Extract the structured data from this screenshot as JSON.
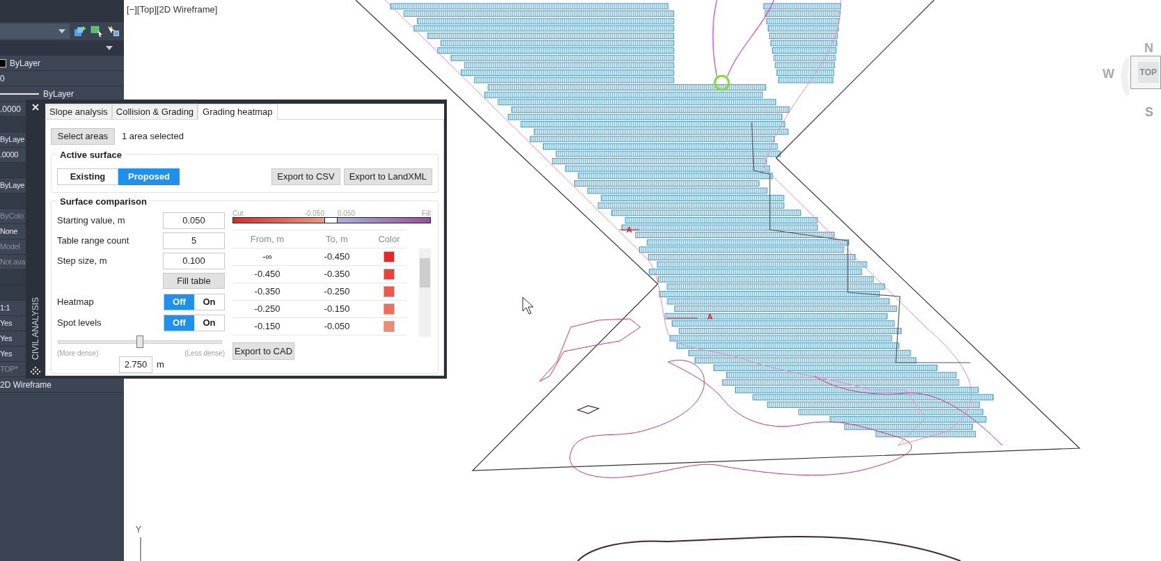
{
  "viewport_label": "[−][Top][2D Wireframe]",
  "properties": {
    "rows": [
      {
        "kind": "swatch",
        "text": "ByLayer",
        "disabled": false
      },
      {
        "kind": "value",
        "text": "0",
        "disabled": false
      },
      {
        "kind": "line",
        "text": "ByLayer",
        "disabled": false
      },
      {
        "kind": "value",
        "text": ".0000",
        "disabled": false
      },
      {
        "kind": "section"
      },
      {
        "kind": "value",
        "text": "ByLaye",
        "disabled": false
      },
      {
        "kind": "value",
        "text": ".0000",
        "disabled": false
      },
      {
        "kind": "section"
      },
      {
        "kind": "value",
        "text": "ByLaye",
        "disabled": false
      },
      {
        "kind": "section"
      },
      {
        "kind": "value",
        "text": "ByColo",
        "disabled": true
      },
      {
        "kind": "value",
        "text": "None",
        "disabled": false
      },
      {
        "kind": "value",
        "text": "Model",
        "disabled": true
      },
      {
        "kind": "value",
        "text": "Not ava",
        "disabled": true
      },
      {
        "kind": "section"
      },
      {
        "kind": "section"
      },
      {
        "kind": "value",
        "text": "1:1",
        "disabled": false
      },
      {
        "kind": "value",
        "text": "Yes",
        "disabled": false
      },
      {
        "kind": "value",
        "text": "Yes",
        "disabled": false
      },
      {
        "kind": "value",
        "text": "Yes",
        "disabled": false
      },
      {
        "kind": "value",
        "text": "TOP*",
        "disabled": true
      },
      {
        "kind": "value",
        "text": "2D Wireframe",
        "disabled": false
      }
    ]
  },
  "dialog": {
    "title": "CIVIL ANALYSIS",
    "tabs": [
      {
        "label": "Slope analysis",
        "selected": false
      },
      {
        "label": "Collision & Grading",
        "selected": false
      },
      {
        "label": "Grading heatmap",
        "selected": true
      }
    ],
    "select_button": "Select areas",
    "selection_status": "1 area selected",
    "active_surface": {
      "title": "Active surface",
      "options": [
        {
          "label": "Existing",
          "selected": false
        },
        {
          "label": "Proposed",
          "selected": true
        }
      ],
      "buttons": [
        "Export to CSV",
        "Export to LandXML"
      ]
    },
    "surface_comparison": {
      "title": "Surface comparison",
      "fields": [
        {
          "label": "Starting value, m",
          "value": "0.050"
        },
        {
          "label": "Table range count",
          "value": "5"
        },
        {
          "label": "Step size, m",
          "value": "0.100"
        }
      ],
      "fill_button": "Fill table",
      "toggles": [
        {
          "label": "Heatmap",
          "options": [
            {
              "label": "Off",
              "selected": true
            },
            {
              "label": "On",
              "selected": false
            }
          ]
        },
        {
          "label": "Spot levels",
          "options": [
            {
              "label": "Off",
              "selected": true
            },
            {
              "label": "On",
              "selected": false
            }
          ]
        }
      ],
      "density_slider": {
        "level": 0.5,
        "min_label": "(More dense)",
        "max_label": "(Less dense)",
        "value": "2.750",
        "unit": "m"
      },
      "scale_labels": [
        "Cut",
        "-0.050",
        "0.050",
        "Fill"
      ],
      "table": {
        "columns": [
          "From, m",
          "To, m",
          "Color"
        ],
        "rows": [
          {
            "from": "-∞",
            "to": "-0.450",
            "color": "#e8262a"
          },
          {
            "from": "-0.450",
            "to": "-0.350",
            "color": "#ec4136"
          },
          {
            "from": "-0.350",
            "to": "-0.250",
            "color": "#ee5a4a"
          },
          {
            "from": "-0.250",
            "to": "-0.150",
            "color": "#ef6e5c"
          },
          {
            "from": "-0.150",
            "to": "-0.050",
            "color": "#f28a70"
          }
        ]
      },
      "export_button": "Export to CAD"
    }
  },
  "viewcube": {
    "north": "N",
    "west": "W",
    "face": "TOP",
    "south": "S"
  },
  "axis_label": "Y",
  "section_marks": [
    "A",
    "A"
  ]
}
